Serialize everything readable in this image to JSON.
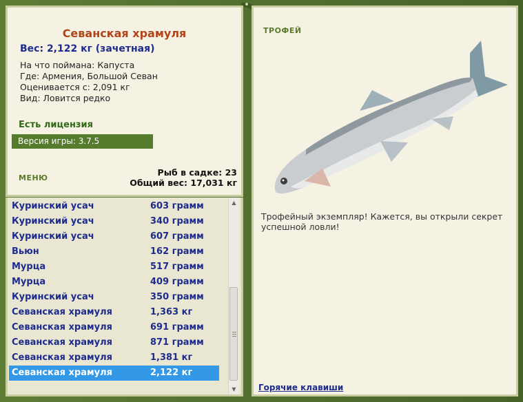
{
  "fish_card": {
    "name": "Севанская храмуля",
    "weight_line": "Вес: 2,122 кг (зачетная)",
    "bait_line": "На что поймана: Капуста",
    "location_line": "Где: Армения, Большой Севан",
    "value_line": "Оценивается с: 2,091 кг",
    "kind_line": "Вид: Ловится редко"
  },
  "license": "Есть лицензия",
  "version": "Версия игры: 3.7.5",
  "menu_label": "МЕНЮ",
  "stats": {
    "count_line": "Рыб в садке: 23",
    "total_line": "Общий вес: 17,031 кг"
  },
  "catch_list": [
    {
      "name": "Куринский усач",
      "weight": "603 грамм"
    },
    {
      "name": "Куринский усач",
      "weight": "340 грамм"
    },
    {
      "name": "Куринский усач",
      "weight": "607 грамм"
    },
    {
      "name": "Вьюн",
      "weight": "162 грамм"
    },
    {
      "name": "Мурца",
      "weight": "517 грамм"
    },
    {
      "name": "Мурца",
      "weight": "409 грамм"
    },
    {
      "name": "Куринский усач",
      "weight": "350 грамм"
    },
    {
      "name": "Севанская храмуля",
      "weight": "1,363 кг"
    },
    {
      "name": "Севанская храмуля",
      "weight": "691 грамм"
    },
    {
      "name": "Севанская храмуля",
      "weight": "871 грамм"
    },
    {
      "name": "Севанская храмуля",
      "weight": "1,381 кг"
    },
    {
      "name": "Севанская храмуля",
      "weight": "2,122 кг",
      "selected": true
    }
  ],
  "trophy": {
    "title": "ТРОФЕЙ",
    "text": "Трофейный экземпляр! Кажется, вы открыли секрет успешной ловли!"
  },
  "hotkeys_link": "Горячие клавиши",
  "colors": {
    "frame_green": "#4f6e2c",
    "panel_bg": "#f5f2e4",
    "fish_name": "#b0441a",
    "list_text": "#1d2c8c",
    "selection": "#3399e6"
  },
  "icons": [
    "lizard-ornament-icon",
    "scroll-up-arrow-icon",
    "scroll-down-arrow-icon"
  ]
}
